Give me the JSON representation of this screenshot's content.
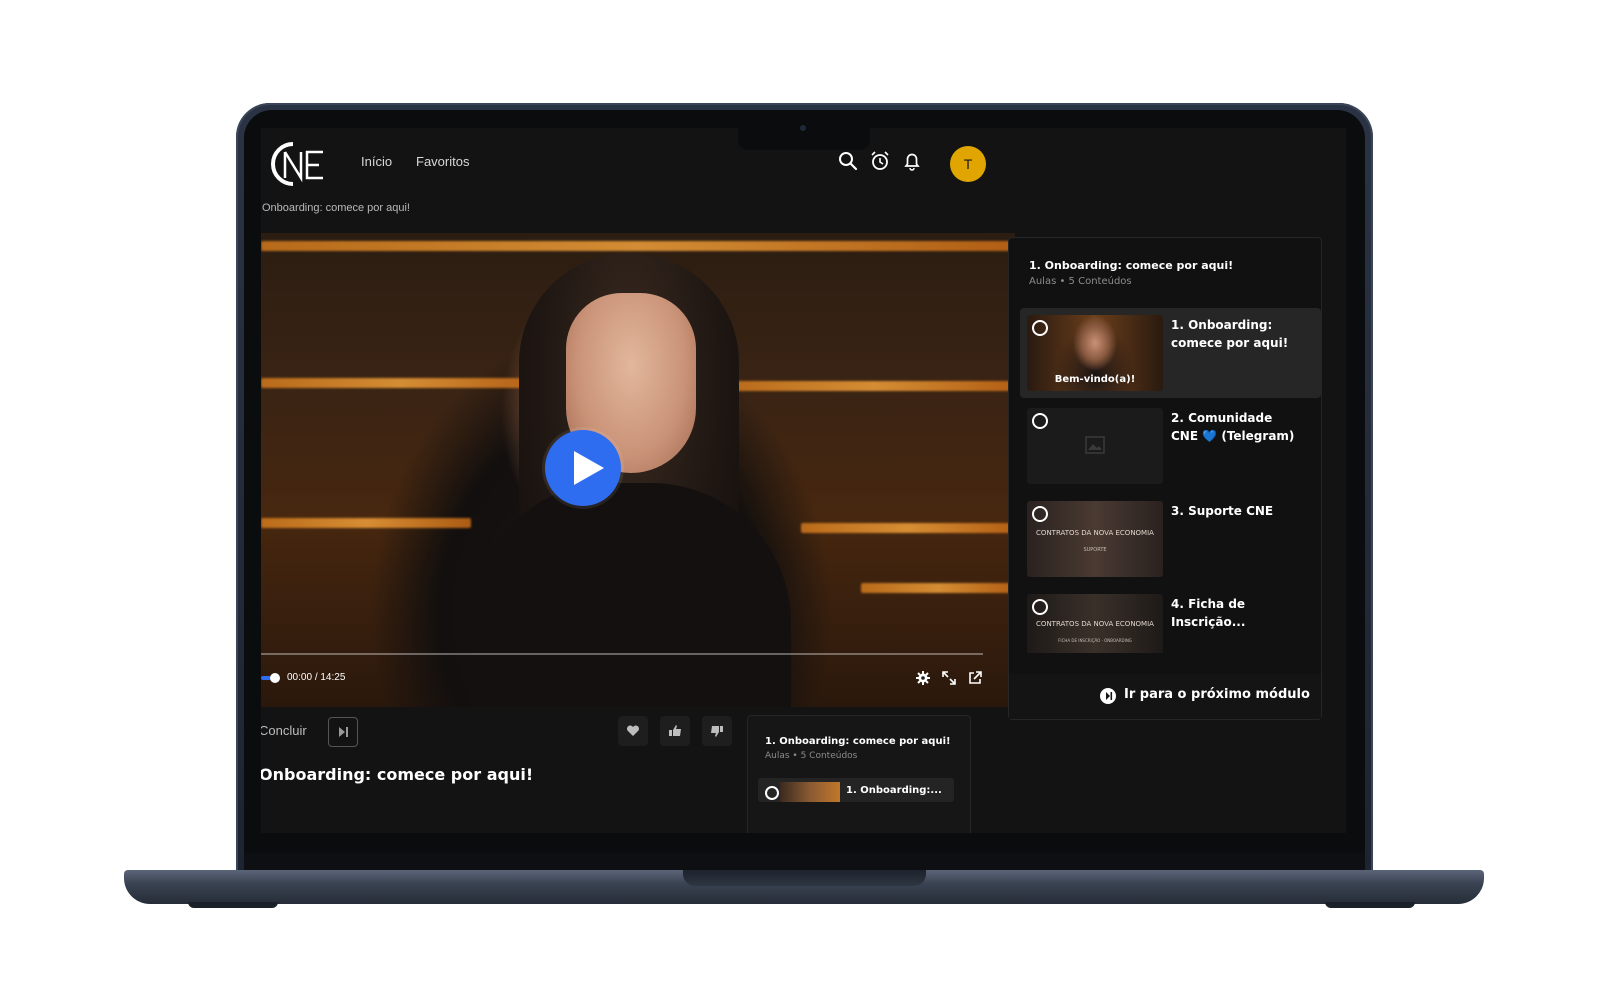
{
  "nav": {
    "logo_text": "CNE",
    "links": [
      "Início",
      "Favoritos"
    ],
    "avatar_initial": "T",
    "icons": [
      "search-icon",
      "alarm-clock-icon",
      "bell-icon"
    ]
  },
  "breadcrumb": "Onboarding: comece por aqui!",
  "player": {
    "current_time": "00:00",
    "separator": "/",
    "duration": "14:25",
    "progress_fraction": 0.0,
    "accent_color": "#2f6df0",
    "controls": [
      "settings-icon",
      "fullscreen-icon",
      "external-link-icon"
    ]
  },
  "lesson": {
    "concluir_label": "Concluir",
    "title": "Onboarding: comece por aqui!",
    "reactions": [
      "heart-icon",
      "thumbs-up-icon",
      "thumbs-down-icon"
    ]
  },
  "mini_panel": {
    "title": "1. Onboarding: comece por aqui!",
    "subtitle": "Aulas • 5 Conteúdos",
    "item_label": "1. Onboarding:..."
  },
  "sidebar": {
    "title": "1. Onboarding: comece por aqui!",
    "subtitle": "Aulas • 5 Conteúdos",
    "items": [
      {
        "label": "1. Onboarding: comece por aqui!",
        "thumb_text": "Bem-vindo(a)!",
        "active": true
      },
      {
        "label": "2. Comunidade CNE 💙 (Telegram)",
        "thumb_text": "",
        "active": false
      },
      {
        "label": "3. Suporte CNE",
        "thumb_text": "CONTRATOS DA NOVA ECONOMIA",
        "thumb_sub": "SUPORTE",
        "active": false
      },
      {
        "label": "4. Ficha de Inscrição...",
        "thumb_text": "CONTRATOS DA NOVA ECONOMIA",
        "thumb_sub": "FICHA DE INSCRIÇÃO · ONBOARDING",
        "active": false
      }
    ],
    "next_module_label": "Ir para o próximo módulo"
  }
}
